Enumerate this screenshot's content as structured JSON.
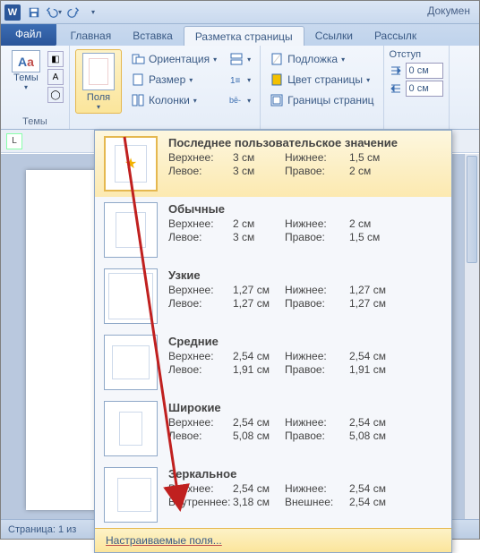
{
  "title": "Докумен",
  "qat": {
    "save": "save",
    "undo": "undo",
    "redo": "redo",
    "refresh": "refresh"
  },
  "tabs": {
    "file": "Файл",
    "home": "Главная",
    "insert": "Вставка",
    "layout": "Разметка страницы",
    "refs": "Ссылки",
    "mail": "Рассылк"
  },
  "ribbon": {
    "themes_label": "Темы",
    "themes_btn": "Темы",
    "margins_label": "Поля",
    "orientation": "Ориентация",
    "size": "Размер",
    "columns": "Колонки",
    "watermark": "Подложка",
    "page_color": "Цвет страницы",
    "borders": "Границы страниц",
    "indent_label": "Отступ",
    "indent_left": "0 см",
    "indent_right": "0 см"
  },
  "ruler_corner": "L",
  "gallery": {
    "presets": [
      {
        "key": "last",
        "name": "Последнее пользовательское значение",
        "top_l": "Верхнее:",
        "top_v": "3 см",
        "bot_l": "Нижнее:",
        "bot_v": "1,5 см",
        "left_l": "Левое:",
        "left_v": "3 см",
        "right_l": "Правое:",
        "right_v": "2 см"
      },
      {
        "key": "normal",
        "name": "Обычные",
        "top_l": "Верхнее:",
        "top_v": "2 см",
        "bot_l": "Нижнее:",
        "bot_v": "2 см",
        "left_l": "Левое:",
        "left_v": "3 см",
        "right_l": "Правое:",
        "right_v": "1,5 см"
      },
      {
        "key": "narrow",
        "name": "Узкие",
        "top_l": "Верхнее:",
        "top_v": "1,27 см",
        "bot_l": "Нижнее:",
        "bot_v": "1,27 см",
        "left_l": "Левое:",
        "left_v": "1,27 см",
        "right_l": "Правое:",
        "right_v": "1,27 см"
      },
      {
        "key": "moderate",
        "name": "Средние",
        "top_l": "Верхнее:",
        "top_v": "2,54 см",
        "bot_l": "Нижнее:",
        "bot_v": "2,54 см",
        "left_l": "Левое:",
        "left_v": "1,91 см",
        "right_l": "Правое:",
        "right_v": "1,91 см"
      },
      {
        "key": "wide",
        "name": "Широкие",
        "top_l": "Верхнее:",
        "top_v": "2,54 см",
        "bot_l": "Нижнее:",
        "bot_v": "2,54 см",
        "left_l": "Левое:",
        "left_v": "5,08 см",
        "right_l": "Правое:",
        "right_v": "5,08 см"
      },
      {
        "key": "mirror",
        "name": "Зеркальное",
        "top_l": "Верхнее:",
        "top_v": "2,54 см",
        "bot_l": "Нижнее:",
        "bot_v": "2,54 см",
        "left_l": "Внутреннее:",
        "left_v": "3,18 см",
        "right_l": "Внешнее:",
        "right_v": "2,54 см"
      }
    ],
    "custom": "Настраиваемые поля..."
  },
  "status": "Страница: 1 из",
  "colors": {
    "accent": "#2b579a",
    "highlight": "#fbe59b",
    "arrow": "#c0201f"
  }
}
